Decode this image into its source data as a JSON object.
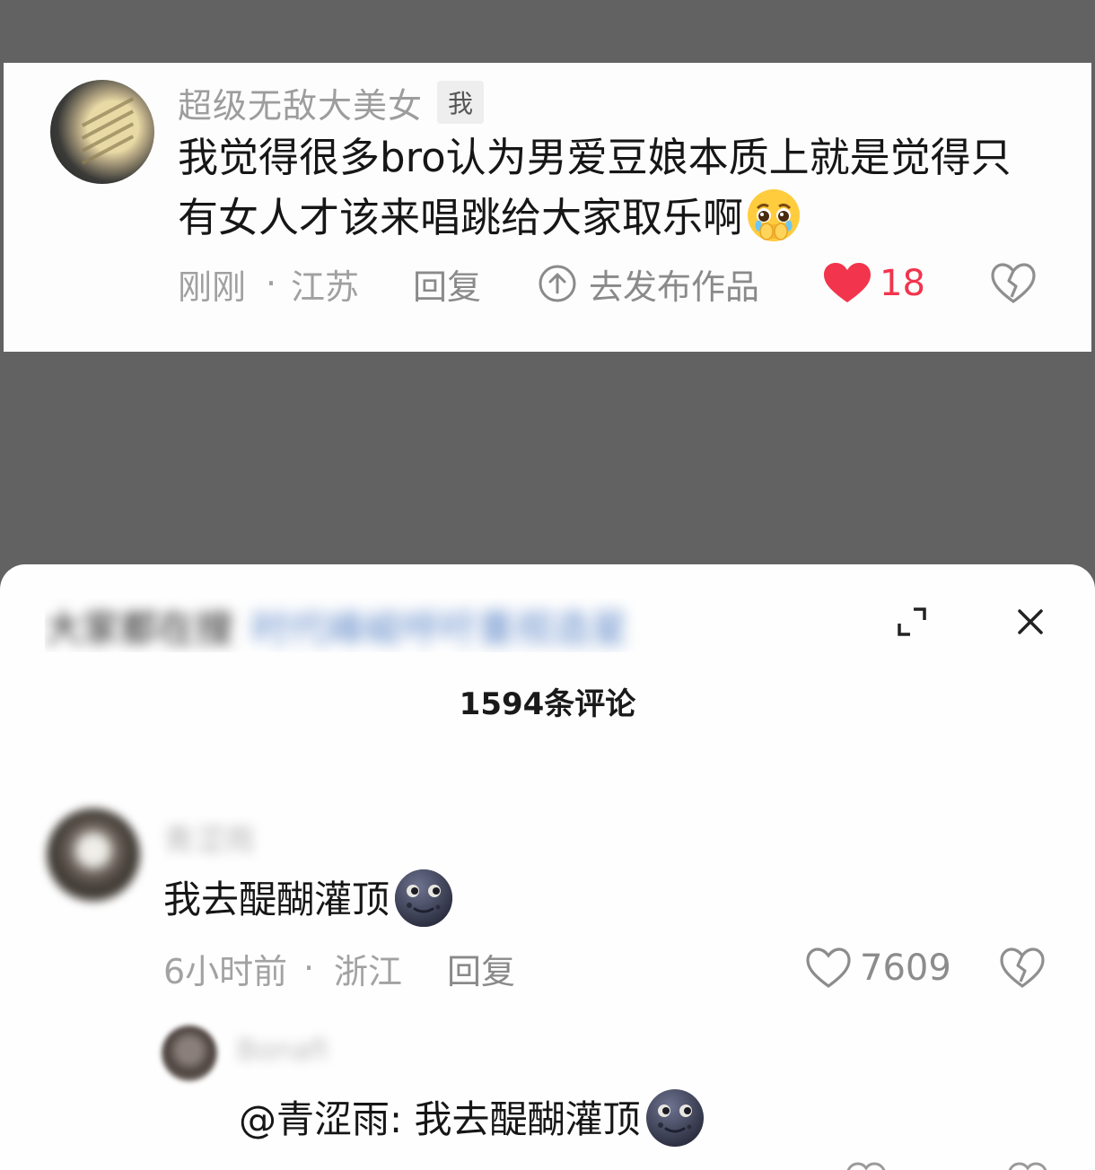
{
  "top_comment": {
    "username": "超级无敌大美女",
    "me_badge": "我",
    "text": "我觉得很多bro认为男爱豆娘本质上就是觉得只有女人才该来唱跳给大家取乐啊",
    "time": "刚刚",
    "dot": "·",
    "location": "江苏",
    "reply_label": "回复",
    "publish_label": "去发布作品",
    "like_count": "18",
    "like_color": "#f2344d",
    "icons": [
      "pleading-face-emoji",
      "upload-arrow-icon",
      "heart-filled-icon",
      "broken-heart-icon"
    ]
  },
  "sheet": {
    "title": "大家都在搜",
    "title_link": "时代峰峻呼吁重视造星",
    "comment_count": "1594条评论",
    "comments": [
      {
        "username": "青涩雨",
        "text": "我去醍醐灌顶",
        "time": "6小时前",
        "dot": "·",
        "location": "浙江",
        "reply_label": "回复",
        "like_count": "7609"
      },
      {
        "username": "Bonafi",
        "text": "@青涩雨: 我去醍醐灌顶"
      }
    ],
    "icons": [
      "expand-icon",
      "close-icon",
      "new-moon-face-emoji",
      "heart-outline-icon",
      "broken-heart-icon"
    ]
  }
}
